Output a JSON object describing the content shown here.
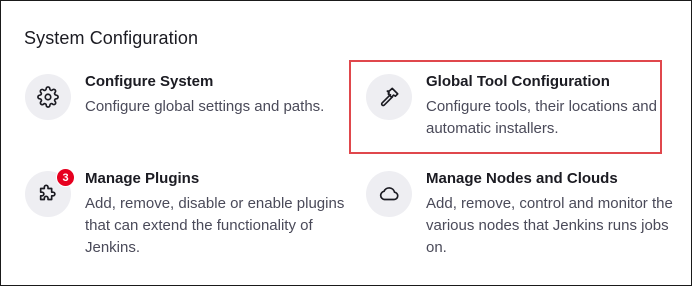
{
  "section": {
    "title": "System Configuration"
  },
  "items": [
    {
      "title": "Configure System",
      "desc": "Configure global settings and paths.",
      "icon": "gear-icon"
    },
    {
      "title": "Global Tool Configuration",
      "desc_line1": "Configure tools, their locations and",
      "desc_line2": "automatic installers.",
      "icon": "hammer-icon"
    },
    {
      "title": "Manage Plugins",
      "desc_line1": "Add, remove, disable or enable plugins",
      "desc_line2": "that can extend the functionality of",
      "desc_line3": "Jenkins.",
      "icon": "puzzle-piece-icon",
      "badge": "3"
    },
    {
      "title": "Manage Nodes and Clouds",
      "desc_line1": "Add, remove, control and monitor the",
      "desc_line2": "various nodes that Jenkins runs jobs",
      "desc_line3": "on.",
      "icon": "cloud-icon"
    }
  ],
  "colors": {
    "highlight": "#e0474c",
    "badge": "#e6001f",
    "icon_bg": "#eeeef2"
  }
}
